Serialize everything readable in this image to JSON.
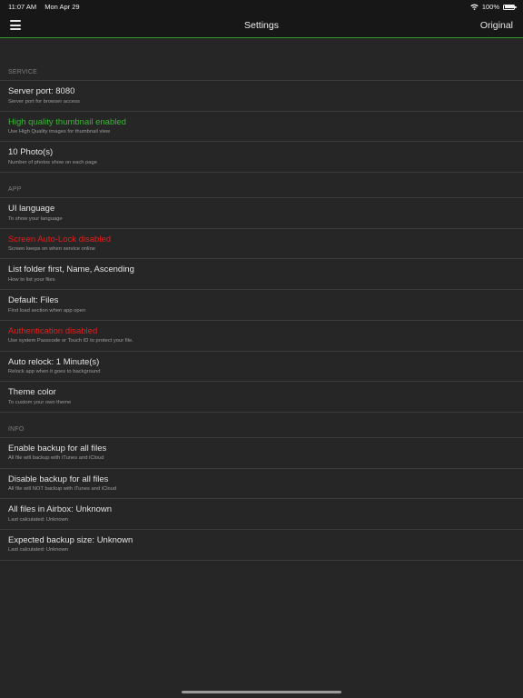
{
  "status_bar": {
    "time": "11:07 AM",
    "date": "Mon Apr 29",
    "battery": "100%",
    "wifi_icon": "wifi-icon",
    "battery_icon": "battery-icon"
  },
  "nav": {
    "title": "Settings",
    "right_label": "Original",
    "menu_icon": "hamburger-menu-icon",
    "accent_color": "#2e9a2a"
  },
  "sections": {
    "service": {
      "header": "SERVICE",
      "rows": [
        {
          "title": "Server port: 8080",
          "subtitle": "Server port for browser access",
          "color": "#e4e4e4"
        },
        {
          "title": "High quality thumbnail enabled",
          "subtitle": "Use High Quality images for thumbnail view",
          "color": "#35b830"
        },
        {
          "title": "10 Photo(s)",
          "subtitle": "Number of photos show on each page",
          "color": "#e4e4e4"
        }
      ]
    },
    "app": {
      "header": "APP",
      "rows": [
        {
          "title": "UI language",
          "subtitle": "To show your language",
          "color": "#e4e4e4"
        },
        {
          "title": "Screen Auto-Lock disabled",
          "subtitle": "Screen keeps on when service online",
          "color": "#e0201e"
        },
        {
          "title": "List folder first, Name, Ascending",
          "subtitle": "How to list your files",
          "color": "#e4e4e4"
        },
        {
          "title": "Default: Files",
          "subtitle": "First load section when app open",
          "color": "#e4e4e4"
        },
        {
          "title": "Authentication disabled",
          "subtitle": "Use system Passcode or Touch ID to protect your file.",
          "color": "#e0201e"
        },
        {
          "title": "Auto relock: 1 Minute(s)",
          "subtitle": "Relock app when it goes to background",
          "color": "#e4e4e4"
        },
        {
          "title": "Theme color",
          "subtitle": "To custom your own theme",
          "color": "#e4e4e4"
        }
      ]
    },
    "info": {
      "header": "INFO",
      "rows": [
        {
          "title": "Enable backup for all files",
          "subtitle": "All file will backup with iTunes and iCloud",
          "color": "#e4e4e4"
        },
        {
          "title": "Disable backup for all files",
          "subtitle": "All file will NOT backup with iTunes and iCloud",
          "color": "#e4e4e4"
        },
        {
          "title": "All files in Airbox: Unknown",
          "subtitle": "Last calculated: Unknown",
          "color": "#e4e4e4"
        },
        {
          "title": "Expected backup size: Unknown",
          "subtitle": "Last calculated: Unknown",
          "color": "#e4e4e4"
        }
      ]
    }
  }
}
